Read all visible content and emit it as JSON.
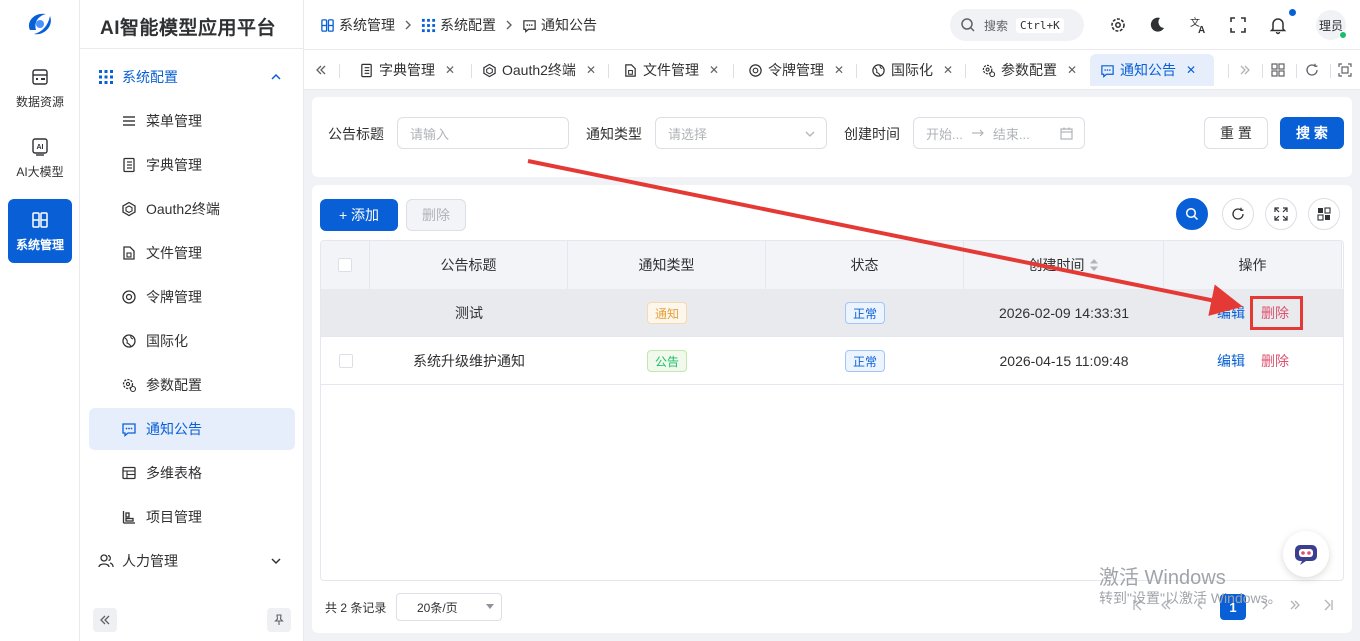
{
  "app": {
    "title": "AI智能模型应用平台"
  },
  "rail": {
    "items": [
      {
        "label": "数据资源",
        "icon": "database-icon"
      },
      {
        "label": "AI大模型",
        "icon": "ai-model-icon"
      },
      {
        "label": "系统管理",
        "icon": "system-icon"
      }
    ]
  },
  "sidebar": {
    "group_config": "系统配置",
    "items": [
      {
        "label": "菜单管理",
        "icon": "menu-list-icon"
      },
      {
        "label": "字典管理",
        "icon": "dictionary-icon"
      },
      {
        "label": "Oauth2终端",
        "icon": "hexagon-icon"
      },
      {
        "label": "文件管理",
        "icon": "file-icon"
      },
      {
        "label": "令牌管理",
        "icon": "token-icon"
      },
      {
        "label": "国际化",
        "icon": "globe-icon"
      },
      {
        "label": "参数配置",
        "icon": "gear-settings-icon"
      },
      {
        "label": "通知公告",
        "icon": "message-icon"
      },
      {
        "label": "多维表格",
        "icon": "table-icon"
      },
      {
        "label": "项目管理",
        "icon": "project-icon"
      }
    ],
    "group_hr": "人力管理"
  },
  "breadcrumb": [
    "系统管理",
    "系统配置",
    "通知公告"
  ],
  "header": {
    "search_placeholder": "搜索",
    "search_shortcut": "Ctrl+K",
    "avatar_text": "理员"
  },
  "tabs": [
    "字典管理",
    "Oauth2终端",
    "文件管理",
    "令牌管理",
    "国际化",
    "参数配置",
    "通知公告"
  ],
  "filter": {
    "title_label": "公告标题",
    "title_placeholder": "请输入",
    "type_label": "通知类型",
    "type_placeholder": "请选择",
    "time_label": "创建时间",
    "time_start": "开始...",
    "time_end": "结束...",
    "reset": "重 置",
    "search": "搜 索"
  },
  "toolbar": {
    "add": "+ 添加",
    "delete": "删除"
  },
  "table": {
    "columns": [
      "公告标题",
      "通知类型",
      "状态",
      "创建时间",
      "操作"
    ],
    "rows": [
      {
        "title": "测试",
        "type": "通知",
        "status": "正常",
        "created": "2026-02-09 14:33:31",
        "edit": "编辑",
        "delete": "删除"
      },
      {
        "title": "系统升级维护通知",
        "type": "公告",
        "status": "正常",
        "created": "2026-04-15 11:09:48",
        "edit": "编辑",
        "delete": "删除"
      }
    ]
  },
  "pagination": {
    "total": "共 2 条记录",
    "page_size": "20条/页",
    "current_page": "1"
  },
  "watermark": {
    "line1": "激活 Windows",
    "line2": "转到\"设置\"以激活 Windows。"
  },
  "colors": {
    "primary": "#0960d6",
    "danger": "#e0506f",
    "warning": "#e6a23c",
    "success": "#19be6b",
    "annotation": "#e53935"
  }
}
